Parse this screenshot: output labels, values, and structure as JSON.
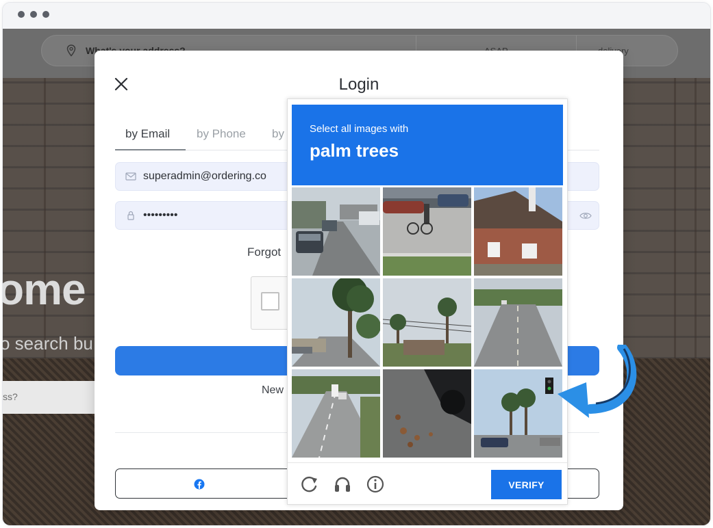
{
  "browser": {
    "window_dots": [
      "dot-1",
      "dot-2",
      "dot-3"
    ]
  },
  "site": {
    "address_placeholder": "What's your address?",
    "time_option": "ASAP",
    "order_type": "delivery",
    "hero_heading": "ome",
    "hero_subtitle": "o search bu",
    "hero_input_placeholder": "ss?"
  },
  "login_modal": {
    "title": "Login",
    "close_icon": "close-icon",
    "tabs": [
      {
        "label": "by Email",
        "active": true
      },
      {
        "label": "by Phone",
        "active": false
      },
      {
        "label": "by",
        "active": false
      }
    ],
    "email_value": "superadmin@ordering.co",
    "password_value": "•••••••••",
    "forgot_text": "Forgot",
    "new_text": "New",
    "social_icon": "facebook-icon",
    "accent_color": "#2c7be5"
  },
  "recaptcha": {
    "instruction": "Select all images with",
    "target": "palm trees",
    "verify_label": "VERIFY",
    "footer_icons": [
      "reload-icon",
      "audio-icon",
      "info-icon"
    ],
    "header_color": "#1a73e8",
    "tiles": [
      {
        "scene": "street-cars"
      },
      {
        "scene": "parking-lot-cyclist"
      },
      {
        "scene": "brick-house"
      },
      {
        "scene": "palm-tree-street"
      },
      {
        "scene": "palm-trees-powerlines"
      },
      {
        "scene": "empty-road"
      },
      {
        "scene": "highway"
      },
      {
        "scene": "car-leaves"
      },
      {
        "scene": "traffic-light-palms"
      }
    ]
  },
  "annotation": {
    "icon": "curved-arrow-icon",
    "color": "#2b8fe6"
  }
}
